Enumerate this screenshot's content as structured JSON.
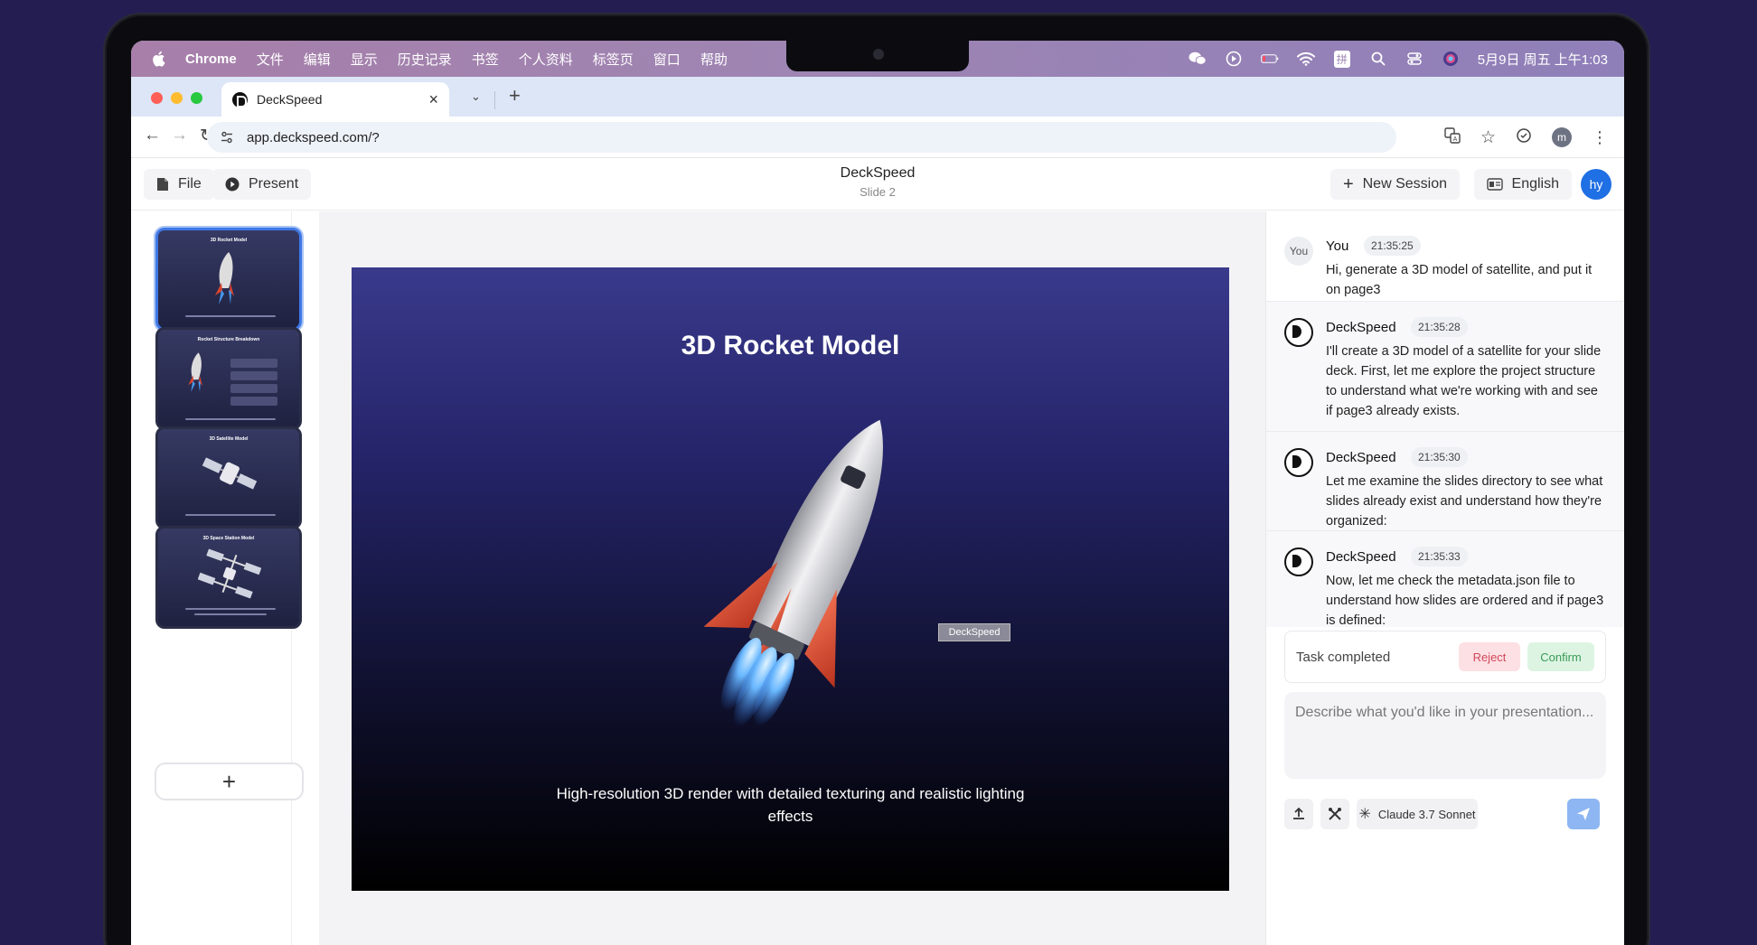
{
  "menubar": {
    "app": "Chrome",
    "items": [
      "文件",
      "编辑",
      "显示",
      "历史记录",
      "书签",
      "个人资料",
      "标签页",
      "窗口",
      "帮助"
    ],
    "clock": "5月9日 周五 上午1:03",
    "input_method": "拼"
  },
  "browser": {
    "tab_title": "DeckSpeed",
    "url": "app.deckspeed.com/?",
    "profile_initial": "m"
  },
  "app": {
    "file_label": "File",
    "present_label": "Present",
    "title": "DeckSpeed",
    "subtitle": "Slide 2",
    "new_session_label": "New Session",
    "language_label": "English",
    "user_initials": "hy"
  },
  "thumbnails": [
    {
      "title": "3D Rocket Model",
      "active": true
    },
    {
      "title": "Rocket Structure Breakdown",
      "active": false
    },
    {
      "title": "3D Satellite Model",
      "active": false
    },
    {
      "title": "3D Space Station Model",
      "active": false
    }
  ],
  "slide": {
    "title": "3D Rocket Model",
    "caption": "High-resolution 3D render with detailed texturing and realistic lighting effects",
    "watermark": "DeckSpeed"
  },
  "chat": {
    "messages": [
      {
        "sender": "You",
        "avatar": "You",
        "time": "21:35:25",
        "text": "Hi, generate a 3D model of satellite, and put it on page3"
      },
      {
        "sender": "DeckSpeed",
        "time": "21:35:28",
        "text": "I'll create a 3D model of a satellite for your slide deck. First, let me explore the project structure to understand what we're working with and see if page3 already exists."
      },
      {
        "sender": "DeckSpeed",
        "time": "21:35:30",
        "text": "Let me examine the slides directory to see what slides already exist and understand how they're organized:"
      },
      {
        "sender": "DeckSpeed",
        "time": "21:35:33",
        "text": "Now, let me check the metadata.json file to understand how slides are ordered and if page3 is defined:"
      }
    ],
    "task_status": "Task completed",
    "reject_label": "Reject",
    "confirm_label": "Confirm",
    "composer_placeholder": "Describe what you'd like in your presentation...",
    "model_label": "Claude 3.7 Sonnet"
  },
  "colors": {
    "accent": "#1f6fe5",
    "background": "#241d52",
    "reject": "#d0485a",
    "confirm": "#3a9b57"
  }
}
